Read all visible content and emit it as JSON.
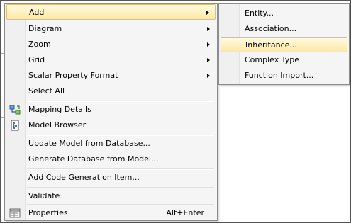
{
  "context_menu": {
    "items": [
      {
        "label": "Add",
        "has_submenu": true
      },
      {
        "label": "Diagram",
        "has_submenu": true
      },
      {
        "label": "Zoom",
        "has_submenu": true
      },
      {
        "label": "Grid",
        "has_submenu": true
      },
      {
        "label": "Scalar Property Format",
        "has_submenu": true
      },
      {
        "label": "Select All"
      },
      {
        "label": "Mapping Details",
        "icon": "mapping-details-icon"
      },
      {
        "label": "Model Browser",
        "icon": "model-browser-icon"
      },
      {
        "label": "Update Model from Database..."
      },
      {
        "label": "Generate Database from Model..."
      },
      {
        "label": "Add Code Generation Item..."
      },
      {
        "label": "Validate"
      },
      {
        "label": "Properties",
        "icon": "properties-icon",
        "shortcut": "Alt+Enter"
      }
    ]
  },
  "add_submenu": {
    "items": [
      {
        "label": "Entity..."
      },
      {
        "label": "Association..."
      },
      {
        "label": "Inheritance...",
        "highlighted": true
      },
      {
        "label": "Complex Type"
      },
      {
        "label": "Function Import..."
      }
    ]
  },
  "colors": {
    "highlight_top": "#fffbe4",
    "highlight_bottom": "#ffe8a3",
    "highlight_border": "#e3c06e",
    "menu_background": "#f5f5f5"
  }
}
